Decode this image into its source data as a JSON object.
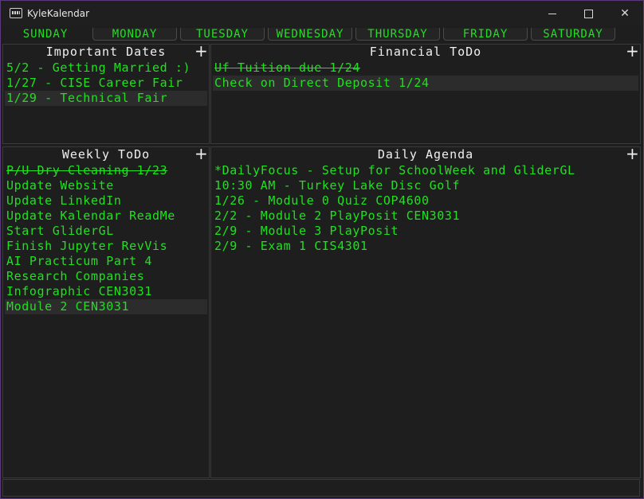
{
  "window": {
    "title": "KyleKalendar"
  },
  "days": [
    {
      "label": "SUNDAY",
      "active": true
    },
    {
      "label": "MONDAY"
    },
    {
      "label": "TUESDAY"
    },
    {
      "label": "WEDNESDAY"
    },
    {
      "label": "THURSDAY"
    },
    {
      "label": "FRIDAY"
    },
    {
      "label": "SATURDAY"
    }
  ],
  "important_dates": {
    "title": "Important Dates",
    "items": [
      {
        "text": "5/2 - Getting Married :)"
      },
      {
        "text": "1/27 - CISE Career Fair"
      },
      {
        "text": "1/29 - Technical Fair",
        "selected": true
      }
    ]
  },
  "financial_todo": {
    "title": "Financial ToDo",
    "items": [
      {
        "text": "Uf Tuition due 1/24",
        "done": true
      },
      {
        "text": "Check on Direct Deposit 1/24",
        "selected": true
      }
    ]
  },
  "weekly_todo": {
    "title": "Weekly ToDo",
    "items": [
      {
        "text": "P/U Dry Cleaning 1/23",
        "done": true
      },
      {
        "text": "Update Website"
      },
      {
        "text": "Update LinkedIn"
      },
      {
        "text": "Update Kalendar ReadMe"
      },
      {
        "text": "Start GliderGL"
      },
      {
        "text": "Finish Jupyter RevVis"
      },
      {
        "text": "AI Practicum Part 4"
      },
      {
        "text": "Research Companies"
      },
      {
        "text": "Infographic CEN3031"
      },
      {
        "text": "Module 2 CEN3031",
        "selected": true
      }
    ]
  },
  "daily_agenda": {
    "title": "Daily Agenda",
    "items": [
      {
        "text": "*DailyFocus - Setup for SchoolWeek and GliderGL"
      },
      {
        "text": "10:30 AM - Turkey Lake Disc Golf"
      },
      {
        "text": "1/26 - Module 0 Quiz COP4600"
      },
      {
        "text": "2/2 - Module 2 PlayPosit CEN3031"
      },
      {
        "text": "2/9 - Module 3 PlayPosit"
      },
      {
        "text": "2/9 - Exam 1 CIS4301"
      }
    ]
  },
  "colors": {
    "accent": "#20e020",
    "background": "#1e1e1e",
    "text": "#f0f0f0"
  },
  "icons": {
    "add": "plus-icon"
  }
}
